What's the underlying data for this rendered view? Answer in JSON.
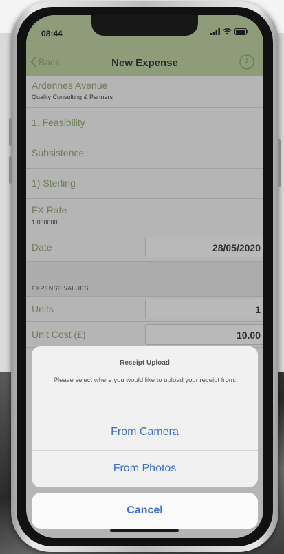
{
  "status": {
    "time": "08:44"
  },
  "nav": {
    "back_label": "Back",
    "title": "New Expense"
  },
  "form": {
    "project": {
      "label": "Ardennes Avenue",
      "sub": "Quality Consulting & Partners"
    },
    "stage": {
      "label": "1. Feasibility"
    },
    "category": {
      "label": "Subsistence"
    },
    "currency": {
      "label": "1) Sterling"
    },
    "fx": {
      "label": "FX Rate",
      "value": "1.000000"
    },
    "date": {
      "label": "Date",
      "value": "28/05/2020"
    },
    "section_header": "EXPENSE VALUES",
    "units": {
      "label": "Units",
      "value": "1"
    },
    "unit_cost": {
      "label": "Unit Cost (£)",
      "value": "10.00"
    }
  },
  "sheet": {
    "title": "Receipt Upload",
    "message": "Please select where you would like to upload your receipt from.",
    "camera_label": "From Camera",
    "photos_label": "From Photos",
    "cancel_label": "Cancel"
  },
  "colors": {
    "nav_bar": "#b7c99a",
    "label_green": "#8aa06a",
    "action_blue": "#3c6fd0"
  }
}
